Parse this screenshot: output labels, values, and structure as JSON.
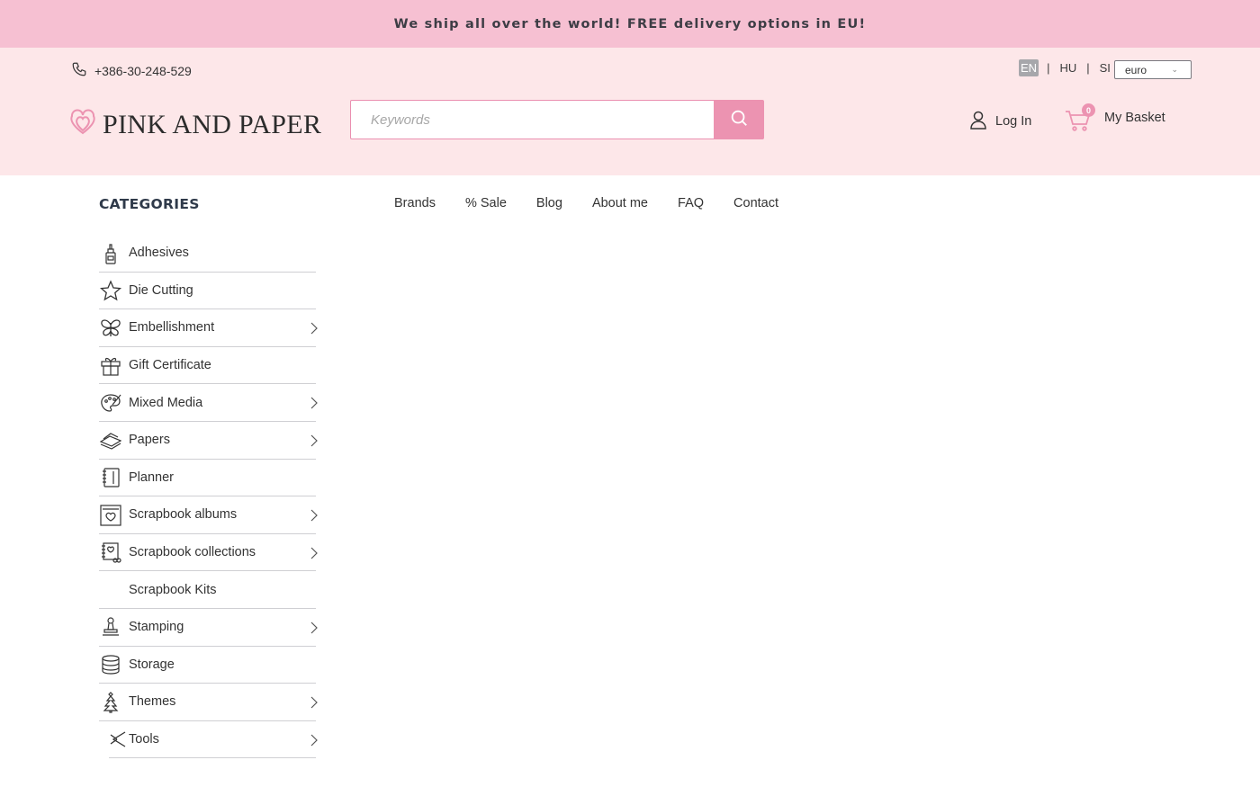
{
  "banner": {
    "text": "We ship all over the world! FREE delivery options in EU!"
  },
  "header": {
    "phone": "+386-30-248-529",
    "languages": [
      "EN",
      "HU",
      "SI"
    ],
    "active_language": "EN",
    "currency": "euro",
    "logo_text": "PINK AND PAPER",
    "search_placeholder": "Keywords",
    "login_label": "Log In",
    "basket_label": "My Basket",
    "basket_count": "0"
  },
  "nav": {
    "items": [
      "Brands",
      "% Sale",
      "Blog",
      "About me",
      "FAQ",
      "Contact"
    ]
  },
  "categories": {
    "title": "CATEGORIES",
    "items": [
      {
        "label": "Adhesives",
        "icon": "glue-icon",
        "has_children": false
      },
      {
        "label": "Die Cutting",
        "icon": "star-icon",
        "has_children": false
      },
      {
        "label": "Embellishment",
        "icon": "butterfly-icon",
        "has_children": true
      },
      {
        "label": "Gift Certificate",
        "icon": "gift-icon",
        "has_children": false
      },
      {
        "label": "Mixed Media",
        "icon": "palette-icon",
        "has_children": true
      },
      {
        "label": "Papers",
        "icon": "paper-stack-icon",
        "has_children": true
      },
      {
        "label": "Planner",
        "icon": "notebook-icon",
        "has_children": false
      },
      {
        "label": "Scrapbook albums",
        "icon": "album-icon",
        "has_children": true
      },
      {
        "label": "Scrapbook collections",
        "icon": "collection-icon",
        "has_children": true
      },
      {
        "label": "Scrapbook Kits",
        "icon": "",
        "has_children": false
      },
      {
        "label": "Stamping",
        "icon": "stamp-icon",
        "has_children": true
      },
      {
        "label": "Storage",
        "icon": "storage-icon",
        "has_children": false
      },
      {
        "label": "Themes",
        "icon": "tree-icon",
        "has_children": true
      },
      {
        "label": "Tools",
        "icon": "scissors-icon",
        "has_children": true
      }
    ]
  },
  "colors": {
    "banner_bg": "#f6c0d2",
    "header_bg": "#fde7e9",
    "accent": "#ec93b1"
  }
}
